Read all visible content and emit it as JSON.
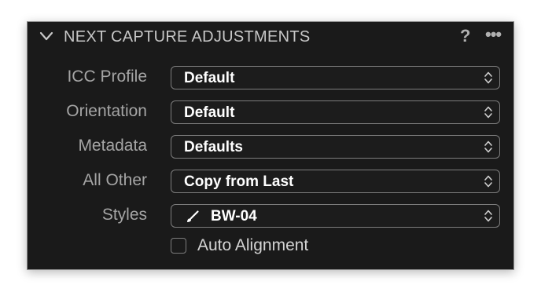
{
  "panel": {
    "title": "NEXT CAPTURE ADJUSTMENTS",
    "help_label": "?",
    "more_label": "•••"
  },
  "rows": [
    {
      "label": "ICC Profile",
      "value": "Default"
    },
    {
      "label": "Orientation",
      "value": "Default"
    },
    {
      "label": "Metadata",
      "value": "Defaults"
    },
    {
      "label": "All Other",
      "value": "Copy from Last"
    },
    {
      "label": "Styles",
      "value": "BW-04",
      "icon": "brush-icon"
    }
  ],
  "auto_alignment": {
    "label": "Auto Alignment",
    "checked": false
  },
  "icons": {
    "collapse": "chevron-down-icon",
    "select_arrows": "up-down-arrows-icon"
  },
  "colors": {
    "panel_bg": "#1a1a1a",
    "title": "#c7c7c7",
    "label": "#a5a5a5",
    "value": "#ffffff",
    "border": "#7d7d7d"
  }
}
